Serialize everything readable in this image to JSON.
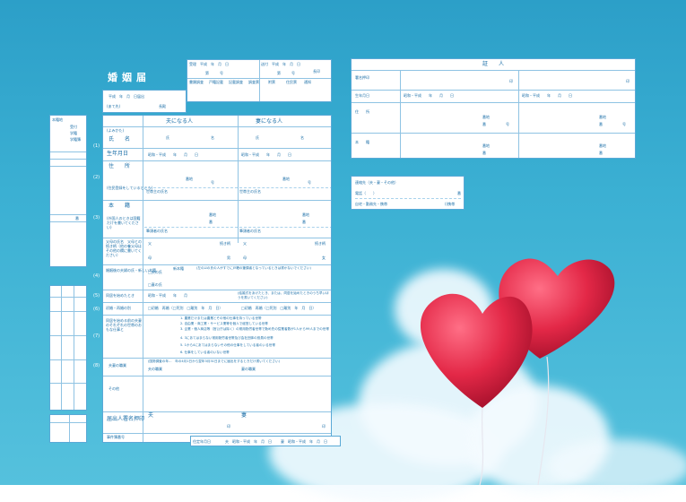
{
  "form": {
    "title": "婚姻届",
    "receipt": {
      "date": "平成　年　月　日届出",
      "addressee": "長殿",
      "seal": "(あて先)"
    },
    "acceptance": {
      "received": "受理　平成　年　月　日",
      "number": "第　　　号",
      "sent": "送付　平成　年　月　日",
      "number2": "第　　　号",
      "seal": "長印",
      "sub1": "書類調査",
      "sub2": "戸籍記載",
      "sub3": "記載調査",
      "sub4": "調査票",
      "sub5": "附票",
      "sub6": "住民票",
      "sub7": "通知"
    },
    "columns": {
      "husband": "夫になる人",
      "wife": "妻になる人",
      "kana": "(よみかた)",
      "surname": "氏",
      "given": "名"
    },
    "rows": {
      "name": "氏　　名",
      "birth": "生年月日",
      "birth_value": "昭和・平成　　年　　月　　日",
      "address": "住　　所",
      "address_note": "(住民登録をしているところ)",
      "banchi": "番地",
      "ban": "番",
      "go": "号",
      "householder": "世帯主の氏名",
      "honseki": "本　　籍",
      "honseki_note": "(外国人のときは国籍だけを書いてください)",
      "head": "筆頭者の氏名",
      "parents": "父母の氏名　父母との続き柄（他の養父母はその他の欄に書いてください）",
      "father": "父",
      "mother": "母",
      "relation": "続き柄",
      "son": "男",
      "daughter": "女",
      "new_surname": "婚姻後の夫婦の氏・新しい本籍",
      "husband_surname": "□夫の氏",
      "wife_surname": "□妻の氏",
      "new_honseki": "新本籍",
      "new_honseki_note": "(左の☑の氏の人がすでに戸籍の筆頭者となっているときは書かないでください)",
      "cohabit": "同居を始めたとき",
      "cohabit_value": "昭和・平成　　年　　月",
      "cohabit_note": "(結婚式をあげたとき、または、同居を始めたときのうち早いほうを書いてください)",
      "previous": "初婚・再婚の別",
      "previous_values": "□初婚　再婚（□死別　□離別　年　月　日）",
      "occupation": "同居を始める前の夫妻のそれぞれの世帯のおもな仕事と",
      "occupation_items": [
        "1. 農業だけまたは農業とその他の仕事を持っている世帯",
        "2. 自由業・商工業・サービス業等を個人で経営している世帯",
        "3. 企業・個人商店等（官公庁は除く）の常用勤労者世帯で勤め先の従業者数が1人から99人までの世帯",
        "4. 3にあてはまらない常用勤労者世帯及び会社団体の役員の世帯",
        "5. 1から4にあてはまらないその他の仕事をしている者のいる世帯",
        "6. 仕事をしている者のいない世帯"
      ],
      "job": "夫妻の職業",
      "job_note": "(国勢調査の年…　年の4月1日から翌年3月31日までに届出をするときだけ書いてください)",
      "husband_job": "夫の職業",
      "wife_job": "妻の職業",
      "other": "その他",
      "signature": "届出人署名押印",
      "signature_husband": "夫",
      "signature_wife": "妻",
      "seal": "印",
      "case_number": "事件簿番号",
      "birthdate_bottom": "住定年月日",
      "bottom_husband": "夫",
      "bottom_wife": "妻",
      "bottom_value": "昭和・平成　年　月　日"
    },
    "side_left": {
      "title": "本籍地",
      "items": [
        "受付",
        "学籍",
        "学籍簿"
      ],
      "labels": [
        "証　書",
        "",
        "番"
      ]
    }
  },
  "witness": {
    "title": "証　　人",
    "rows": {
      "signature": "署名押印",
      "seal": "印",
      "birth": "生年月日",
      "birth_value": "昭和・平成　　年　　月　　日",
      "address": "住　　所",
      "honseki": "本　　籍",
      "banchi": "番地",
      "ban": "番",
      "go": "号"
    }
  },
  "contact": {
    "title": "連絡先（夫・妻・その他）",
    "phone": "電話（　　）",
    "phone_suffix": "番",
    "type": "自宅・勤務先・携帯",
    "type_suffix": "()携帯"
  },
  "colors": {
    "sky": "#3bb0d3",
    "form_line": "#5aa9d6",
    "balloon": "#e8304e"
  }
}
